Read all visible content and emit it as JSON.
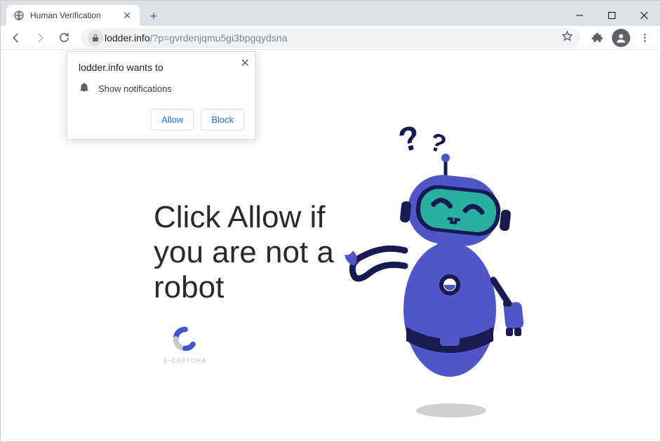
{
  "tab": {
    "title": "Human Verification"
  },
  "url": {
    "host": "lodder.info",
    "path": "/?p=gvrdenjqmu5gi3bpgqydsna"
  },
  "permission": {
    "title": "lodder.info wants to",
    "request": "Show notifications",
    "allow": "Allow",
    "block": "Block"
  },
  "page": {
    "heading": "Click Allow if you are not a robot",
    "captcha_label": "E-CAPTCHA"
  }
}
